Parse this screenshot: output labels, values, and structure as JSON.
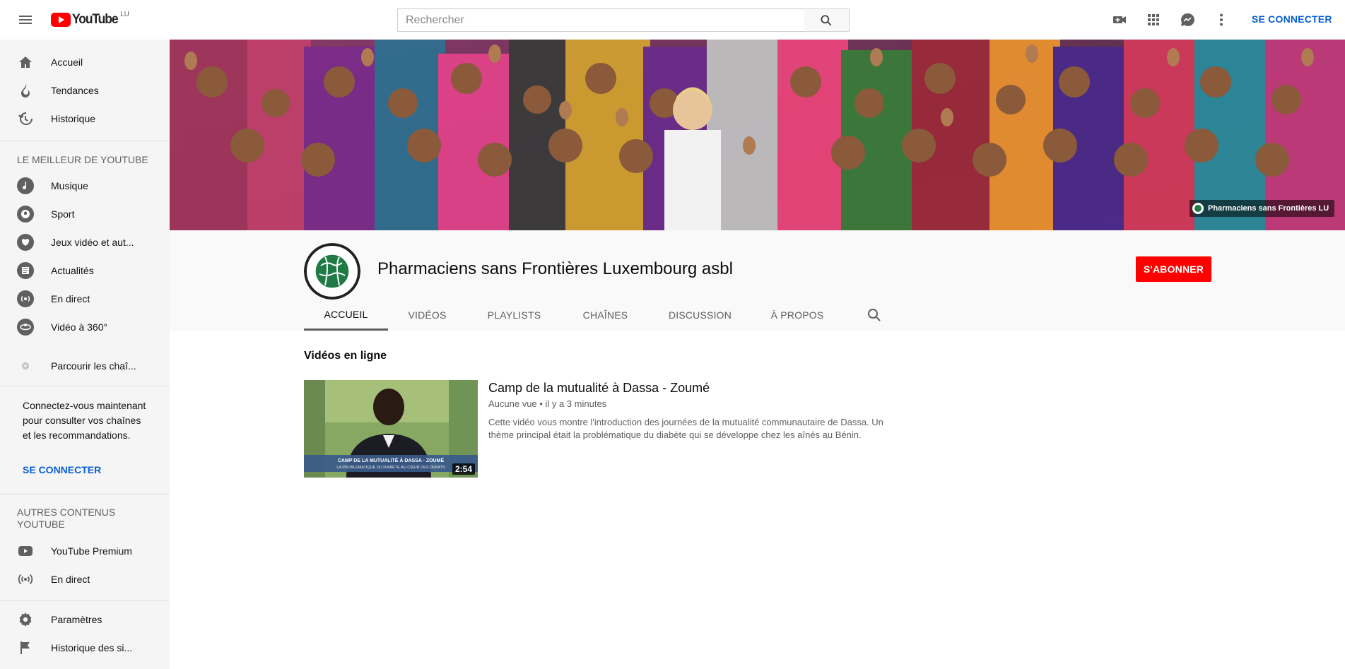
{
  "masthead": {
    "logo_text": "YouTube",
    "country_code": "LU",
    "search_placeholder": "Rechercher",
    "signin_label": "SE CONNECTER"
  },
  "sidebar": {
    "main_items": [
      {
        "label": "Accueil",
        "icon": "home-icon"
      },
      {
        "label": "Tendances",
        "icon": "flame-icon"
      },
      {
        "label": "Historique",
        "icon": "history-icon"
      }
    ],
    "best_heading": "LE MEILLEUR DE YOUTUBE",
    "best_items": [
      {
        "label": "Musique",
        "icon": "music-icon"
      },
      {
        "label": "Sport",
        "icon": "sport-icon"
      },
      {
        "label": "Jeux vidéo et aut...",
        "icon": "gaming-icon"
      },
      {
        "label": "Actualités",
        "icon": "news-icon"
      },
      {
        "label": "En direct",
        "icon": "live-icon"
      },
      {
        "label": "Vidéo à 360°",
        "icon": "360-icon"
      }
    ],
    "browse_label": "Parcourir les chaî...",
    "signin_prompt": "Connectez-vous maintenant pour consulter vos chaînes et les recommandations.",
    "signin_label": "SE CONNECTER",
    "more_heading": "AUTRES CONTENUS YOUTUBE",
    "more_items": [
      {
        "label": "YouTube Premium",
        "icon": "youtube-premium-icon"
      },
      {
        "label": "En direct",
        "icon": "broadcast-icon"
      }
    ],
    "settings_items": [
      {
        "label": "Paramètres",
        "icon": "gear-icon"
      },
      {
        "label": "Historique des si...",
        "icon": "flag-icon"
      }
    ]
  },
  "banner": {
    "credit": "Pharmaciens sans Frontières LU"
  },
  "channel": {
    "title": "Pharmaciens sans Frontières Luxembourg asbl",
    "subscribe_label": "S'ABONNER",
    "tabs": [
      {
        "label": "ACCUEIL",
        "active": true
      },
      {
        "label": "VIDÉOS",
        "active": false
      },
      {
        "label": "PLAYLISTS",
        "active": false
      },
      {
        "label": "CHAÎNES",
        "active": false
      },
      {
        "label": "DISCUSSION",
        "active": false
      },
      {
        "label": "À PROPOS",
        "active": false
      }
    ]
  },
  "content": {
    "section_title": "Vidéos en ligne",
    "video": {
      "title": "Camp de la mutualité à Dassa - Zoumé",
      "views": "Aucune vue",
      "separator": "•",
      "age": "il y a 3 minutes",
      "description": "Cette vidéo vous montre l'introduction des journées de la mutualité communautaire de Dassa. Un thème principal était la problématique du diabète qui se développe chez les aînés au Bénin.",
      "duration": "2:54",
      "thumb_caption_1": "CAMP DE LA MUTUALITÉ À DASSA - ZOUMÉ",
      "thumb_caption_2": "LA PROBLÉMATIQUE DU DIABÈTE AU CŒUR DES DÉBATS"
    }
  },
  "colors": {
    "brand_red": "#ff0000",
    "link_blue": "#065fd4",
    "sidebar_bg": "#f5f5f5",
    "header_bg": "#f9f9f9"
  }
}
